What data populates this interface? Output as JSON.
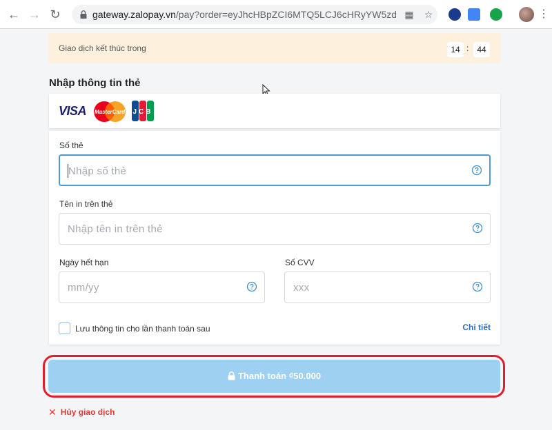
{
  "browser": {
    "url_domain": "gateway.zalopay.vn",
    "url_path": "/pay?order=eyJhcHBpZCI6MTQ5LCJ6cHRyYW5zdG9r..."
  },
  "timer": {
    "label": "Giao dịch kết thúc trong",
    "minutes": "14",
    "separator": ":",
    "seconds": "44"
  },
  "form": {
    "title": "Nhập thông tin thẻ",
    "brands": [
      "VISA",
      "MasterCard",
      "JCB"
    ],
    "card_number": {
      "label": "Số thẻ",
      "placeholder": "Nhập số thẻ",
      "value": ""
    },
    "card_name": {
      "label": "Tên in trên thẻ",
      "placeholder": "Nhập tên in trên thẻ",
      "value": ""
    },
    "expiry": {
      "label": "Ngày hết hạn",
      "placeholder": "mm/yy",
      "value": ""
    },
    "cvv": {
      "label": "Số CVV",
      "placeholder": "xxx",
      "value": ""
    },
    "save_info_label": "Lưu thông tin cho lần thanh toán sau",
    "detail_link": "Chi tiết"
  },
  "pay_button": {
    "label": "Thanh toán ₫50.000"
  },
  "cancel": {
    "label": "Hủy giao dịch"
  },
  "colors": {
    "accent": "#4a9bd8",
    "pay_button": "#9ed0f2",
    "highlight": "#e21d2c",
    "timer_bg": "#fdf0dc"
  }
}
